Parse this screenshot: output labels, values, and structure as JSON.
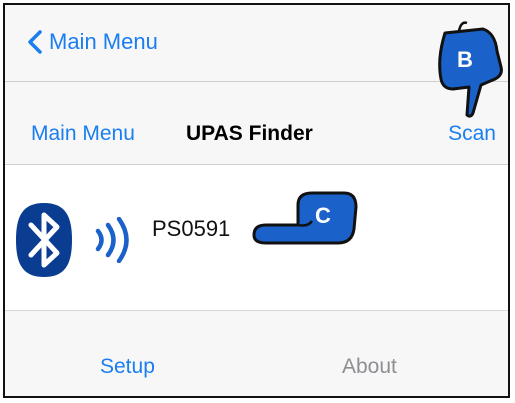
{
  "nav_top": {
    "back_label": "Main Menu"
  },
  "nav_bar": {
    "left_label": "Main Menu",
    "title": "UPAS Finder",
    "right_label": "Scan"
  },
  "device": {
    "name": "PS0591",
    "icon": "bluetooth-icon",
    "signal_icon": "signal-waves-icon"
  },
  "tabbar": {
    "setup_label": "Setup",
    "about_label": "About"
  },
  "callouts": {
    "b_label": "B",
    "c_label": "C"
  },
  "colors": {
    "accent": "#1a7ef0",
    "bluetooth": "#0a3d91",
    "callout": "#1a62c9",
    "inactive": "#8e8e93"
  }
}
